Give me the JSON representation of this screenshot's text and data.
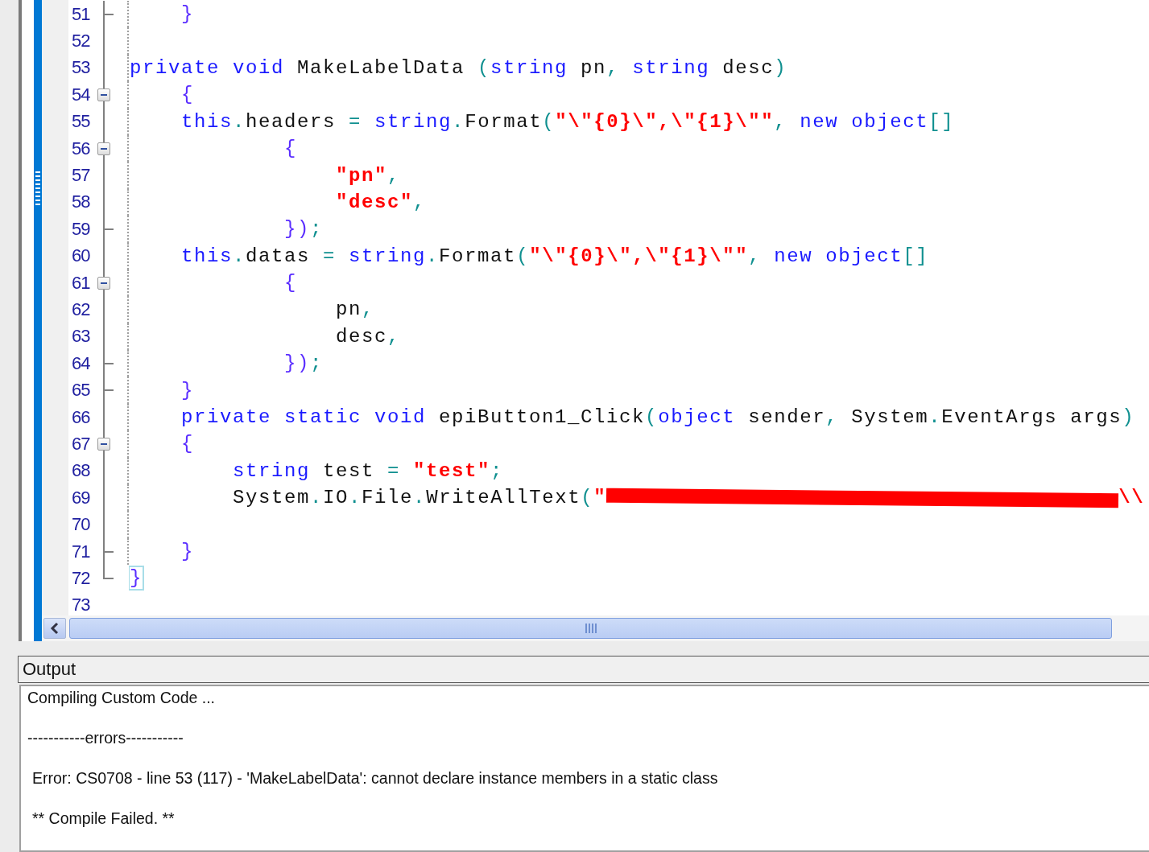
{
  "editor": {
    "lines": [
      {
        "number": "51",
        "kind": "end",
        "tokens": [
          {
            "kind": "brace",
            "text": "    }"
          }
        ]
      },
      {
        "number": "52",
        "kind": "line"
      },
      {
        "number": "53",
        "kind": "line",
        "tokens": [
          {
            "kind": "kw",
            "text": "private void"
          },
          {
            "kind": "id",
            "text": " MakeLabelData "
          },
          {
            "kind": "op",
            "text": "("
          },
          {
            "kind": "kw",
            "text": "string"
          },
          {
            "kind": "id",
            "text": " pn"
          },
          {
            "kind": "op",
            "text": ", "
          },
          {
            "kind": "kw",
            "text": "string"
          },
          {
            "kind": "id",
            "text": " desc"
          },
          {
            "kind": "op",
            "text": ")"
          }
        ]
      },
      {
        "number": "54",
        "kind": "start",
        "tokens": [
          {
            "kind": "brace",
            "text": "    {"
          }
        ]
      },
      {
        "number": "55",
        "kind": "line",
        "tokens": [
          {
            "kind": "kw",
            "text": "    this"
          },
          {
            "kind": "op",
            "text": "."
          },
          {
            "kind": "id",
            "text": "headers "
          },
          {
            "kind": "op",
            "text": "= "
          },
          {
            "kind": "kw",
            "text": "string"
          },
          {
            "kind": "op",
            "text": "."
          },
          {
            "kind": "id",
            "text": "Format"
          },
          {
            "kind": "op",
            "text": "("
          },
          {
            "kind": "str",
            "text": "\"\\\"{0}\\\",\\\"{1}\\\"\""
          },
          {
            "kind": "op",
            "text": ", "
          },
          {
            "kind": "kw",
            "text": "new object"
          },
          {
            "kind": "op",
            "text": "[]"
          }
        ]
      },
      {
        "number": "56",
        "kind": "start",
        "tokens": [
          {
            "kind": "brace",
            "text": "            {"
          }
        ]
      },
      {
        "number": "57",
        "kind": "line",
        "tokens": [
          {
            "kind": "str",
            "text": "                \"pn\""
          },
          {
            "kind": "op",
            "text": ","
          }
        ]
      },
      {
        "number": "58",
        "kind": "line",
        "tokens": [
          {
            "kind": "str",
            "text": "                \"desc\""
          },
          {
            "kind": "op",
            "text": ","
          }
        ]
      },
      {
        "number": "59",
        "kind": "end",
        "tokens": [
          {
            "kind": "brace",
            "text": "            })"
          },
          {
            "kind": "op",
            "text": ";"
          }
        ]
      },
      {
        "number": "60",
        "kind": "line",
        "tokens": [
          {
            "kind": "kw",
            "text": "    this"
          },
          {
            "kind": "op",
            "text": "."
          },
          {
            "kind": "id",
            "text": "datas "
          },
          {
            "kind": "op",
            "text": "= "
          },
          {
            "kind": "kw",
            "text": "string"
          },
          {
            "kind": "op",
            "text": "."
          },
          {
            "kind": "id",
            "text": "Format"
          },
          {
            "kind": "op",
            "text": "("
          },
          {
            "kind": "str",
            "text": "\"\\\"{0}\\\",\\\"{1}\\\"\""
          },
          {
            "kind": "op",
            "text": ", "
          },
          {
            "kind": "kw",
            "text": "new object"
          },
          {
            "kind": "op",
            "text": "[]"
          }
        ]
      },
      {
        "number": "61",
        "kind": "start",
        "tokens": [
          {
            "kind": "brace",
            "text": "            {"
          }
        ]
      },
      {
        "number": "62",
        "kind": "line",
        "tokens": [
          {
            "kind": "id",
            "text": "                pn"
          },
          {
            "kind": "op",
            "text": ","
          }
        ]
      },
      {
        "number": "63",
        "kind": "line",
        "tokens": [
          {
            "kind": "id",
            "text": "                desc"
          },
          {
            "kind": "op",
            "text": ","
          }
        ]
      },
      {
        "number": "64",
        "kind": "end",
        "tokens": [
          {
            "kind": "brace",
            "text": "            })"
          },
          {
            "kind": "op",
            "text": ";"
          }
        ]
      },
      {
        "number": "65",
        "kind": "end",
        "tokens": [
          {
            "kind": "brace",
            "text": "    }"
          }
        ]
      },
      {
        "number": "66",
        "kind": "line",
        "tokens": [
          {
            "kind": "kw",
            "text": "    private static void"
          },
          {
            "kind": "id",
            "text": " epiButton1_Click"
          },
          {
            "kind": "op",
            "text": "("
          },
          {
            "kind": "kw",
            "text": "object"
          },
          {
            "kind": "id",
            "text": " sender"
          },
          {
            "kind": "op",
            "text": ", "
          },
          {
            "kind": "id",
            "text": "System"
          },
          {
            "kind": "op",
            "text": "."
          },
          {
            "kind": "id",
            "text": "EventArgs args"
          },
          {
            "kind": "op",
            "text": ")"
          }
        ]
      },
      {
        "number": "67",
        "kind": "start",
        "tokens": [
          {
            "kind": "brace",
            "text": "    {"
          }
        ]
      },
      {
        "number": "68",
        "kind": "line",
        "tokens": [
          {
            "kind": "kw",
            "text": "        string"
          },
          {
            "kind": "id",
            "text": " test "
          },
          {
            "kind": "op",
            "text": "= "
          },
          {
            "kind": "str",
            "text": "\"test\""
          },
          {
            "kind": "op",
            "text": ";"
          }
        ]
      },
      {
        "number": "69",
        "kind": "line",
        "tokens": [
          {
            "kind": "id",
            "text": "        System"
          },
          {
            "kind": "op",
            "text": "."
          },
          {
            "kind": "id",
            "text": "IO"
          },
          {
            "kind": "op",
            "text": "."
          },
          {
            "kind": "id",
            "text": "File"
          },
          {
            "kind": "op",
            "text": "."
          },
          {
            "kind": "id",
            "text": "WriteAllText"
          },
          {
            "kind": "op",
            "text": "("
          },
          {
            "kind": "str",
            "text": "\""
          },
          {
            "kind": "redacted"
          },
          {
            "kind": "str",
            "text": "\\\\"
          }
        ]
      },
      {
        "number": "70",
        "kind": "line"
      },
      {
        "number": "71",
        "kind": "end",
        "tokens": [
          {
            "kind": "brace",
            "text": "    }"
          }
        ]
      },
      {
        "number": "72",
        "kind": "corner",
        "tokens": [
          {
            "kind": "brace-match",
            "text": "}"
          }
        ]
      },
      {
        "number": "73",
        "kind": "none"
      }
    ]
  },
  "output": {
    "title": "Output",
    "lines": [
      {
        "text": "Compiling Custom Code ..."
      },
      {
        "text": "-----------errors-----------"
      },
      {
        "text": "Error: CS0708 - line 53 (117) - 'MakeLabelData': cannot declare instance members in a static class"
      },
      {
        "text": "** Compile Failed. **"
      }
    ]
  }
}
